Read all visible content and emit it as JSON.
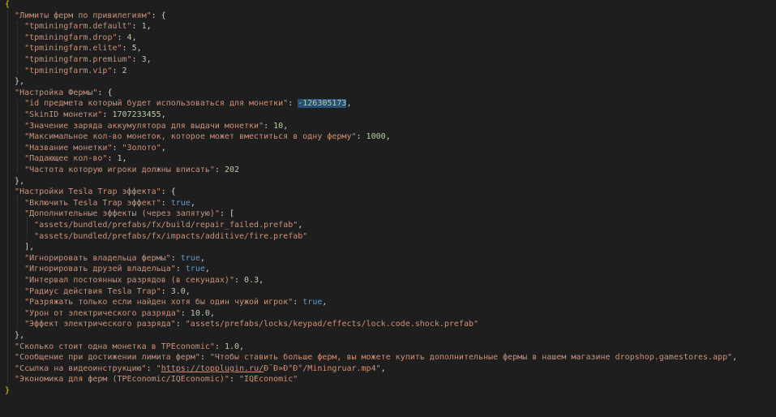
{
  "lines": [
    [
      {
        "t": "{",
        "c": "br"
      }
    ],
    [
      {
        "t": "  "
      },
      {
        "t": "\"Лимиты ферм по привилегиям\"",
        "c": "k"
      },
      {
        "t": ": {",
        "c": "p"
      }
    ],
    [
      {
        "t": "    "
      },
      {
        "t": "\"tpminingfarm.default\"",
        "c": "k"
      },
      {
        "t": ": ",
        "c": "p"
      },
      {
        "t": "1",
        "c": "n"
      },
      {
        "t": ",",
        "c": "p"
      }
    ],
    [
      {
        "t": "    "
      },
      {
        "t": "\"tpminingfarm.drop\"",
        "c": "k"
      },
      {
        "t": ": ",
        "c": "p"
      },
      {
        "t": "4",
        "c": "n"
      },
      {
        "t": ",",
        "c": "p"
      }
    ],
    [
      {
        "t": "    "
      },
      {
        "t": "\"tpminingfarm.elite\"",
        "c": "k"
      },
      {
        "t": ": ",
        "c": "p"
      },
      {
        "t": "5",
        "c": "n"
      },
      {
        "t": ",",
        "c": "p"
      }
    ],
    [
      {
        "t": "    "
      },
      {
        "t": "\"tpminingfarm.premium\"",
        "c": "k"
      },
      {
        "t": ": ",
        "c": "p"
      },
      {
        "t": "3",
        "c": "n"
      },
      {
        "t": ",",
        "c": "p"
      }
    ],
    [
      {
        "t": "    "
      },
      {
        "t": "\"tpminingfarm.vip\"",
        "c": "k"
      },
      {
        "t": ": ",
        "c": "p"
      },
      {
        "t": "2",
        "c": "n"
      }
    ],
    [
      {
        "t": "  "
      },
      {
        "t": "},",
        "c": "p"
      }
    ],
    [
      {
        "t": "  "
      },
      {
        "t": "\"Настройка Фермы\"",
        "c": "k"
      },
      {
        "t": ": {",
        "c": "p"
      }
    ],
    [
      {
        "t": "    "
      },
      {
        "t": "\"id предмета который будет использоваться для монетки\"",
        "c": "k"
      },
      {
        "t": ": ",
        "c": "p"
      },
      {
        "t": "-126305173",
        "c": "n",
        "sel": true
      },
      {
        "t": ",",
        "c": "p"
      }
    ],
    [
      {
        "t": "    "
      },
      {
        "t": "\"SkinID монетки\"",
        "c": "k"
      },
      {
        "t": ": ",
        "c": "p"
      },
      {
        "t": "1707233455",
        "c": "n"
      },
      {
        "t": ",",
        "c": "p"
      }
    ],
    [
      {
        "t": "    "
      },
      {
        "t": "\"Значение заряда аккумулятора для выдачи монетки\"",
        "c": "k"
      },
      {
        "t": ": ",
        "c": "p"
      },
      {
        "t": "10",
        "c": "n"
      },
      {
        "t": ",",
        "c": "p"
      }
    ],
    [
      {
        "t": "    "
      },
      {
        "t": "\"Максимальное кол-во монеток, которое может вместиться в одну ферму\"",
        "c": "k"
      },
      {
        "t": ": ",
        "c": "p"
      },
      {
        "t": "1000",
        "c": "n"
      },
      {
        "t": ",",
        "c": "p"
      }
    ],
    [
      {
        "t": "    "
      },
      {
        "t": "\"Название монетки\"",
        "c": "k"
      },
      {
        "t": ": ",
        "c": "p"
      },
      {
        "t": "\"Золото\"",
        "c": "s"
      },
      {
        "t": ",",
        "c": "p"
      }
    ],
    [
      {
        "t": "    "
      },
      {
        "t": "\"Падающее кол-во\"",
        "c": "k"
      },
      {
        "t": ": ",
        "c": "p"
      },
      {
        "t": "1",
        "c": "n"
      },
      {
        "t": ",",
        "c": "p"
      }
    ],
    [
      {
        "t": "    "
      },
      {
        "t": "\"Частота которую игроки должны вписать\"",
        "c": "k"
      },
      {
        "t": ": ",
        "c": "p"
      },
      {
        "t": "202",
        "c": "n"
      }
    ],
    [
      {
        "t": "  "
      },
      {
        "t": "},",
        "c": "p"
      }
    ],
    [
      {
        "t": "  "
      },
      {
        "t": "\"Настройки Tesla Trap эффекта\"",
        "c": "k"
      },
      {
        "t": ": {",
        "c": "p"
      }
    ],
    [
      {
        "t": "    "
      },
      {
        "t": "\"Включить Tesla Trap эффект\"",
        "c": "k"
      },
      {
        "t": ": ",
        "c": "p"
      },
      {
        "t": "true",
        "c": "b"
      },
      {
        "t": ",",
        "c": "p"
      }
    ],
    [
      {
        "t": "    "
      },
      {
        "t": "\"Дополнительные эффекты (через запятую)\"",
        "c": "k"
      },
      {
        "t": ": [",
        "c": "p"
      }
    ],
    [
      {
        "t": "      "
      },
      {
        "t": "\"assets/bundled/prefabs/fx/build/repair_failed.prefab\"",
        "c": "s"
      },
      {
        "t": ",",
        "c": "p"
      }
    ],
    [
      {
        "t": "      "
      },
      {
        "t": "\"assets/bundled/prefabs/fx/impacts/additive/fire.prefab\"",
        "c": "s"
      }
    ],
    [
      {
        "t": "    "
      },
      {
        "t": "],",
        "c": "p"
      }
    ],
    [
      {
        "t": "    "
      },
      {
        "t": "\"Игнорировать владельца фермы\"",
        "c": "k"
      },
      {
        "t": ": ",
        "c": "p"
      },
      {
        "t": "true",
        "c": "b"
      },
      {
        "t": ",",
        "c": "p"
      }
    ],
    [
      {
        "t": "    "
      },
      {
        "t": "\"Игнорировать друзей владельца\"",
        "c": "k"
      },
      {
        "t": ": ",
        "c": "p"
      },
      {
        "t": "true",
        "c": "b"
      },
      {
        "t": ",",
        "c": "p"
      }
    ],
    [
      {
        "t": "    "
      },
      {
        "t": "\"Интервал постоянных разрядов (в секундах)\"",
        "c": "k"
      },
      {
        "t": ": ",
        "c": "p"
      },
      {
        "t": "0.3",
        "c": "n"
      },
      {
        "t": ",",
        "c": "p"
      }
    ],
    [
      {
        "t": "    "
      },
      {
        "t": "\"Радиус действия Tesla Trap\"",
        "c": "k"
      },
      {
        "t": ": ",
        "c": "p"
      },
      {
        "t": "3.0",
        "c": "n"
      },
      {
        "t": ",",
        "c": "p"
      }
    ],
    [
      {
        "t": "    "
      },
      {
        "t": "\"Разряжать только если найден хотя бы один чужой игрок\"",
        "c": "k"
      },
      {
        "t": ": ",
        "c": "p"
      },
      {
        "t": "true",
        "c": "b"
      },
      {
        "t": ",",
        "c": "p"
      }
    ],
    [
      {
        "t": "    "
      },
      {
        "t": "\"Урон от электрического разряда\"",
        "c": "k"
      },
      {
        "t": ": ",
        "c": "p"
      },
      {
        "t": "10.0",
        "c": "n"
      },
      {
        "t": ",",
        "c": "p"
      }
    ],
    [
      {
        "t": "    "
      },
      {
        "t": "\"Эффект электрического разряда\"",
        "c": "k"
      },
      {
        "t": ": ",
        "c": "p"
      },
      {
        "t": "\"assets/prefabs/locks/keypad/effects/lock.code.shock.prefab\"",
        "c": "s"
      }
    ],
    [
      {
        "t": "  "
      },
      {
        "t": "},",
        "c": "p"
      }
    ],
    [
      {
        "t": "  "
      },
      {
        "t": "\"Сколько стоит одна монетка в TPEconomic\"",
        "c": "k"
      },
      {
        "t": ": ",
        "c": "p"
      },
      {
        "t": "1.0",
        "c": "n"
      },
      {
        "t": ",",
        "c": "p"
      }
    ],
    [
      {
        "t": "  "
      },
      {
        "t": "\"Сообщение при достижении лимита ферм\"",
        "c": "k"
      },
      {
        "t": ": ",
        "c": "p"
      },
      {
        "t": "\"Чтобы ставить больше ферм, вы можете купить дополнительные фермы в нашем магазине dropshop.gamestores.app\"",
        "c": "s"
      },
      {
        "t": ",",
        "c": "p"
      }
    ],
    [
      {
        "t": "  "
      },
      {
        "t": "\"Ссылка на видеоинструкцию\"",
        "c": "k"
      },
      {
        "t": ": ",
        "c": "p"
      },
      {
        "t": "\"",
        "c": "s"
      },
      {
        "t": "https://topplugin.ru/",
        "c": "link"
      },
      {
        "t": "Ð¯Ð»Ð°Ð°/Miningruar.mp4\"",
        "c": "s"
      },
      {
        "t": ",",
        "c": "p"
      }
    ],
    [
      {
        "t": "  "
      },
      {
        "t": "\"Экономика для ферм (TPEconomic/IQEconomic)\"",
        "c": "k"
      },
      {
        "t": ": ",
        "c": "p"
      },
      {
        "t": "\"IQEconomic\"",
        "c": "s"
      }
    ],
    [
      {
        "t": "}",
        "c": "br"
      }
    ]
  ]
}
